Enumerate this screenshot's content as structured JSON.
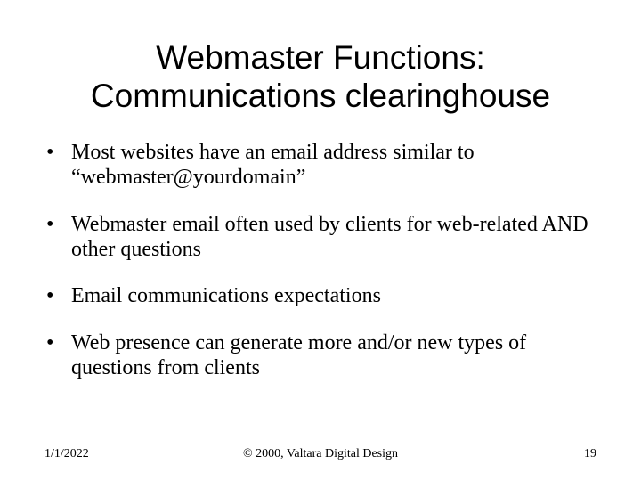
{
  "title_line1": "Webmaster Functions:",
  "title_line2": "Communications clearinghouse",
  "bullets": {
    "b0": "Most websites have an email address similar to “webmaster@yourdomain”",
    "b1": "Webmaster email often used by clients for web-related AND other questions",
    "b2": "Email communications expectations",
    "b3": "Web presence can generate more and/or new types of questions from clients"
  },
  "footer": {
    "date": "1/1/2022",
    "copyright": "© 2000, Valtara Digital Design",
    "page": "19"
  }
}
